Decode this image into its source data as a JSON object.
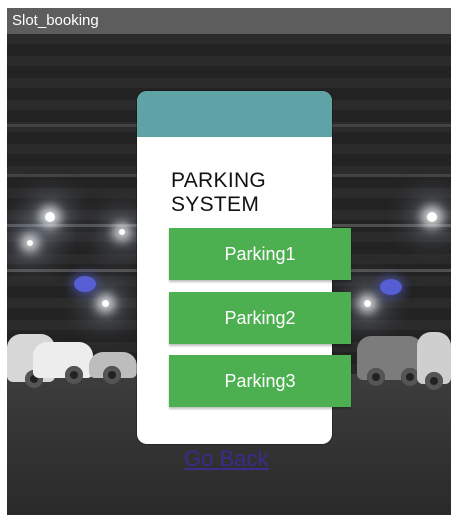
{
  "window": {
    "title": "Slot_booking"
  },
  "card": {
    "title_line1": "PARKING",
    "title_line2": "SYSTEM"
  },
  "buttons": [
    {
      "label": "Parking1"
    },
    {
      "label": "Parking2"
    },
    {
      "label": "Parking3"
    }
  ],
  "link": {
    "go_back": "Go Back"
  },
  "colors": {
    "title_bar": "#5d5d5d",
    "card_header": "#5fa3a6",
    "button_green": "#4caf50",
    "link": "#3b2b8c"
  }
}
